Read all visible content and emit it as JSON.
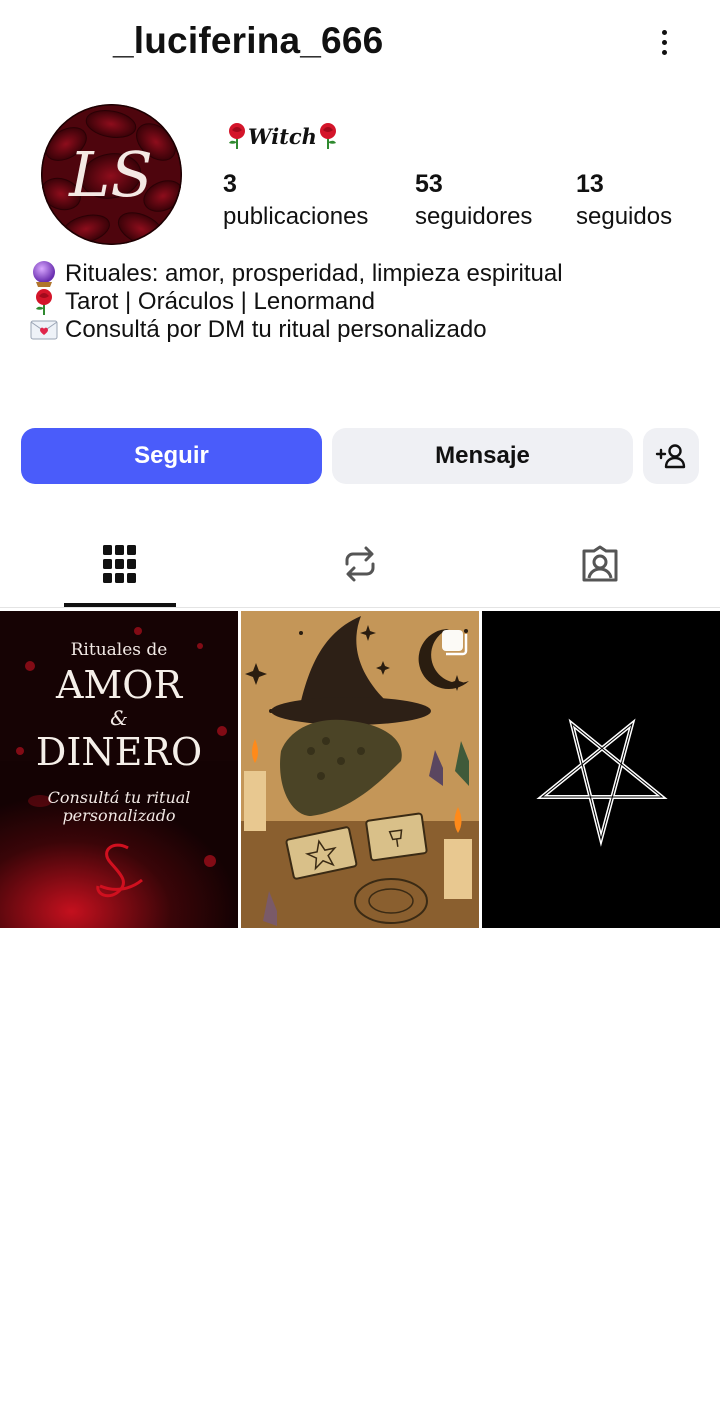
{
  "header": {
    "username": "_luciferina_666",
    "more_icon": "more-vertical-icon"
  },
  "profile": {
    "avatar_monogram": "LS",
    "display_name": "Witch",
    "stats": [
      {
        "value": "3",
        "label": "publicaciones"
      },
      {
        "value": "53",
        "label": "seguidores"
      },
      {
        "value": "13",
        "label": "seguidos"
      }
    ],
    "bio": [
      {
        "icon": "crystal-ball-icon",
        "text": "Rituales: amor, prosperidad, limpieza espiritual"
      },
      {
        "icon": "rose-icon",
        "text": "Tarot | Oráculos | Lenormand"
      },
      {
        "icon": "love-letter-icon",
        "text": "Consultá por DM tu ritual personalizado"
      }
    ]
  },
  "actions": {
    "follow_label": "Seguir",
    "message_label": "Mensaje",
    "add_user_icon": "add-user-icon"
  },
  "tabs": [
    {
      "icon": "grid-icon",
      "active": true
    },
    {
      "icon": "repost-icon",
      "active": false
    },
    {
      "icon": "tagged-icon",
      "active": false
    }
  ],
  "posts": [
    {
      "line1": "Rituales de",
      "line2": "AMOR",
      "line3": "&",
      "line4": "DINERO",
      "line5": "Consultá tu ritual",
      "line6": "personalizado"
    },
    {
      "image": "witch-lizard-tarot-illustration",
      "multi_icon": "carousel-icon"
    },
    {
      "image": "pentagram"
    }
  ],
  "colors": {
    "follow_button": "#4a5cfa",
    "secondary_button": "#eff0f4",
    "text": "#111111"
  }
}
